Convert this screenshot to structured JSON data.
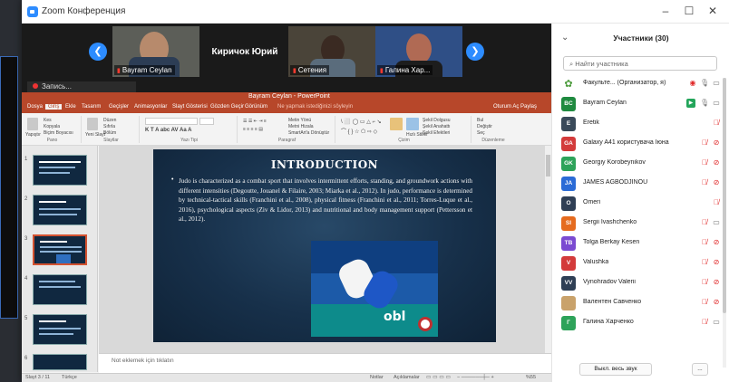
{
  "window": {
    "title": "Zoom Конференция",
    "minimize": "–",
    "maximize": "☐",
    "close": "✕"
  },
  "gallery": {
    "prev": "❮",
    "next": "❯",
    "tiles": [
      {
        "name": "Bayram Ceylan"
      },
      {
        "name": "Киричок Юрий"
      },
      {
        "name": "Сетения"
      },
      {
        "name": "Галина  Хар..."
      }
    ],
    "recording_label": "Запись..."
  },
  "powerpoint": {
    "title": "Bayram Ceylan - PowerPoint",
    "tabs": [
      "Dosya",
      "Giriş",
      "Ekle",
      "Tasarım",
      "Geçişler",
      "Animasyonlar",
      "Slayt Gösterisi",
      "Gözden Geçir",
      "Görünüm",
      "Ne yapmak istediğinizi söyleyin"
    ],
    "share": "Oturum Aç  Paylaş",
    "groups": [
      "Pano",
      "Slaytlar",
      "Yazı Tipi",
      "Paragraf",
      "Çizim",
      "Düzenleme"
    ],
    "ribbon_texts": [
      "Kes",
      "Kopyala",
      "Biçim Boyacısı",
      "Yapıştır",
      "Yeni Slayt",
      "Düzen",
      "Sıfırla",
      "Bölüm",
      "Metin Yönü",
      "Metni Hizala",
      "SmartArt'a Dönüştür",
      "Şekil Dolgusu",
      "Şekil Anahattı",
      "Şekil Efektleri",
      "Bul",
      "Değiştir",
      "Seç",
      "Düzenle",
      "Hızlı Stiller"
    ],
    "slide_numbers": [
      "1",
      "2",
      "3",
      "4",
      "5",
      "6"
    ],
    "slide": {
      "title": "INTRODUCTION",
      "body": "Judo is characterized as a combat sport that involves intermittent efforts, standing, and groundwork actions with different intensities (Degoutte, Jouanel & Filaire, 2003; Miarka et al., 2012). In judo, performance is determined by technical-tactical skills (Franchini et al., 2008), physical fitness (Franchini et al., 2011; Torres-Luque et al., 2016), psychological aspects (Ziv & Lidor, 2013) and nutritional and body management support (Pettersson et al., 2012)."
    },
    "notes_placeholder": "Not eklemek için tıklatın",
    "status_left": "Slayt 3 / 11",
    "status_lang": "Türkçe",
    "status_notes": "Notlar",
    "status_comments": "Açıklamalar",
    "status_zoom": "%55"
  },
  "participants": {
    "title": "Участники (30)",
    "search_placeholder": "Найти участника",
    "items": [
      {
        "initials": "",
        "name": "Факульте... (Организатор, я)",
        "color": "#ffffff",
        "share": false,
        "mic": "gray",
        "cam": "gray",
        "rec": true
      },
      {
        "initials": "BC",
        "name": "Bayram Ceylan",
        "color": "#1f8a3f",
        "share": true,
        "mic": "gray",
        "cam": "gray"
      },
      {
        "initials": "E",
        "name": "Eretik",
        "color": "#3a4a5a",
        "mic": "red",
        "cam": "none"
      },
      {
        "initials": "GA",
        "name": "Galaxy A41 користувача Іюна",
        "color": "#d33b3b",
        "mic": "red",
        "cam": "red"
      },
      {
        "initials": "GK",
        "name": "Georgiy Korobeynikov",
        "color": "#2ea35a",
        "mic": "red",
        "cam": "red"
      },
      {
        "initials": "JA",
        "name": "JAMES AGBODJINOU",
        "color": "#2b6bd6",
        "mic": "red",
        "cam": "red"
      },
      {
        "initials": "O",
        "name": "Omeri",
        "color": "#2f3f55",
        "mic": "red",
        "cam": "none"
      },
      {
        "initials": "SI",
        "name": "Sergii Ivashchenko",
        "color": "#e56b1f",
        "mic": "red",
        "cam": "gray"
      },
      {
        "initials": "TB",
        "name": "Tolga Berkay Kesen",
        "color": "#7b4bd1",
        "mic": "red",
        "cam": "red"
      },
      {
        "initials": "V",
        "name": "Valushka",
        "color": "#d33b3b",
        "mic": "red",
        "cam": "red"
      },
      {
        "initials": "VV",
        "name": "Vynohradov Valerii",
        "color": "#2f3f55",
        "mic": "red",
        "cam": "red"
      },
      {
        "initials": "",
        "name": "Валентен Савченко",
        "color": "#c9a26b",
        "mic": "red",
        "cam": "red"
      },
      {
        "initials": "Г",
        "name": "Галина  Харченко",
        "color": "#2ea35a",
        "mic": "red",
        "cam": "gray"
      }
    ],
    "mute_all": "Выкл. весь звук",
    "more": "..."
  }
}
